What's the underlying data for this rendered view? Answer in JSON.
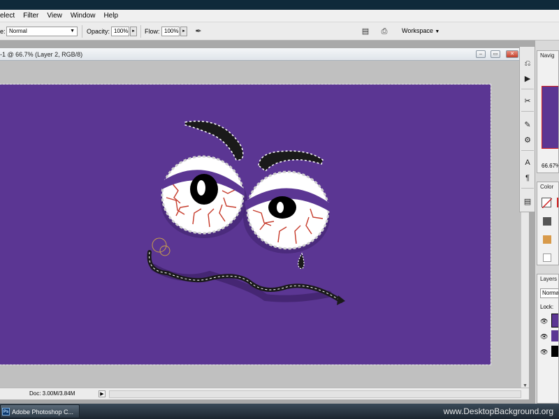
{
  "menu": [
    "elect",
    "Filter",
    "View",
    "Window",
    "Help"
  ],
  "options": {
    "mode_label": "e:",
    "mode_value": "Normal",
    "opacity_label": "Opacity:",
    "opacity_value": "100%",
    "flow_label": "Flow:",
    "flow_value": "100%",
    "workspace_label": "Workspace"
  },
  "document": {
    "title": "-1 @ 66.7% (Layer 2, RGB/8)",
    "status": "Doc: 3.00M/3.84M",
    "canvas_color": "#5b3693"
  },
  "panels": {
    "navigator_tab": "Navig",
    "zoom": "66.67%",
    "color_tab": "Color",
    "layers_tab": "Layers",
    "blend_mode": "Normal",
    "lock_label": "Lock:"
  },
  "taskbar": {
    "app_button": "Adobe Photoshop C...",
    "watermark": "www.DesktopBackground.org"
  },
  "icons": {
    "ps_icon": "Ps"
  }
}
